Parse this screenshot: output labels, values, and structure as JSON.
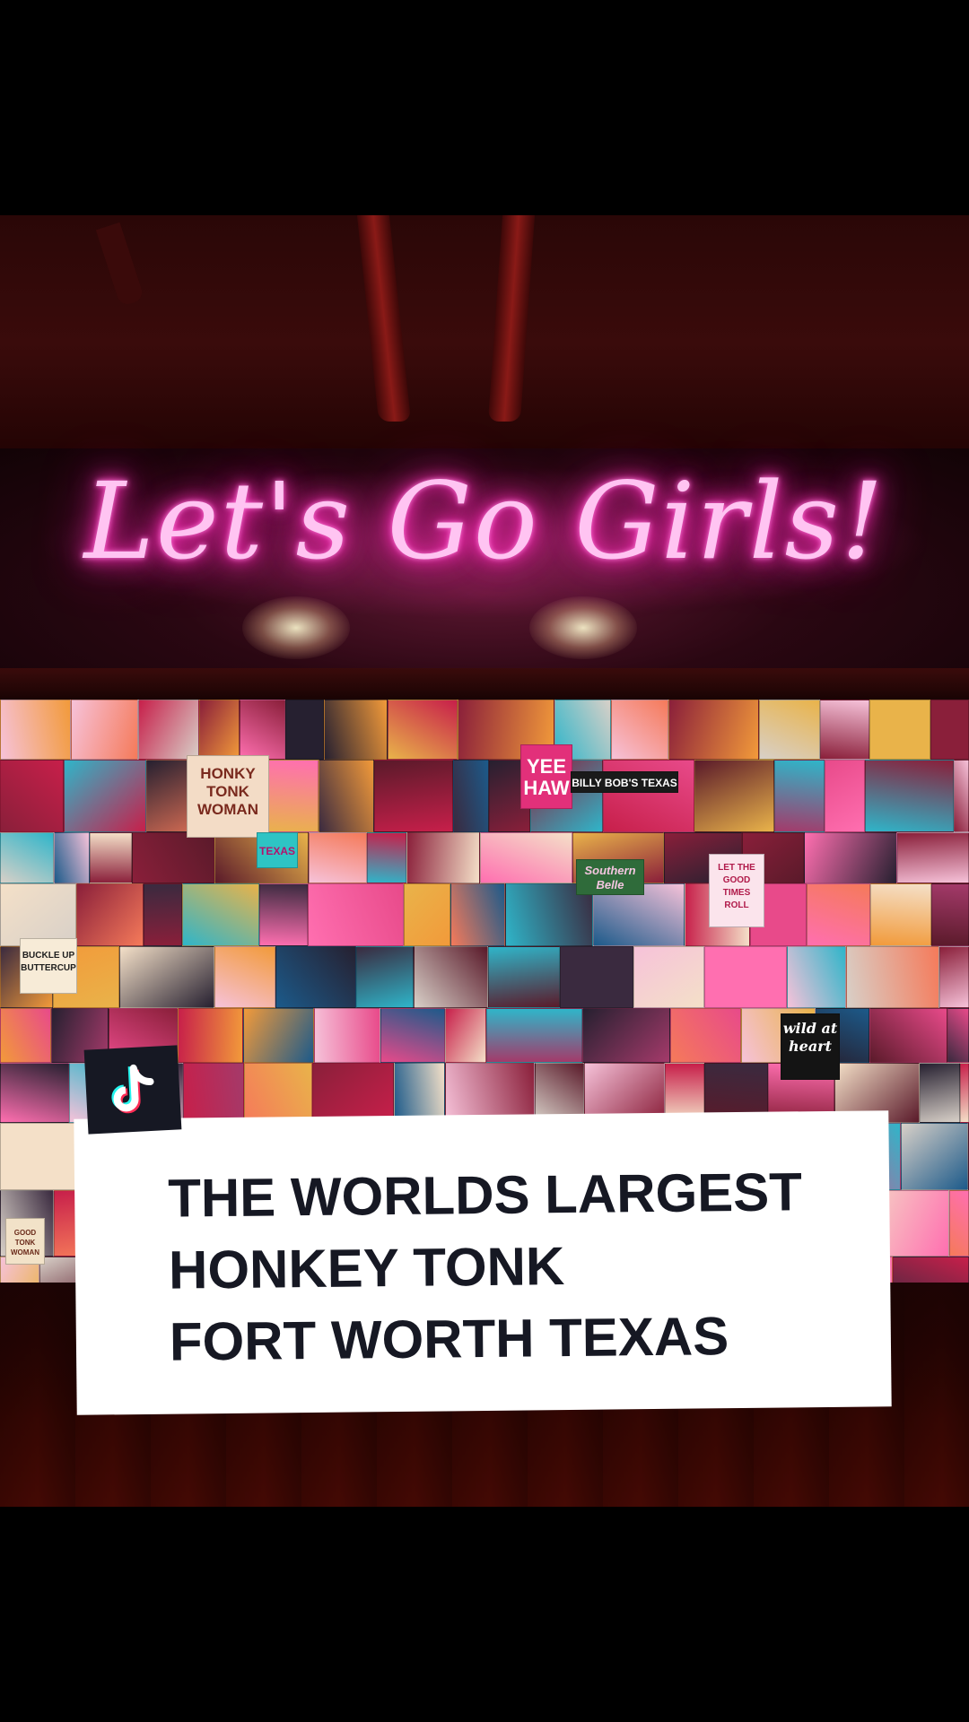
{
  "neon_sign": {
    "text": "Let's Go Girls!",
    "color": "#ff2fb8"
  },
  "collage_labels": [
    "HONKY TONK WOMAN",
    "YEE HAW",
    "BILLY BOB'S TEXAS",
    "TEXAS",
    "Southern Belle",
    "LET THE GOOD TIMES ROLL",
    "BUCKLE UP BUTTERCUP",
    "wild at heart",
    "GOOD TONK WOMAN"
  ],
  "overlay": {
    "badge_icon": "tiktok-note-icon",
    "badge_color": "#161823",
    "caption_lines": [
      "THE WORLDS LARGEST",
      "HONKEY TONK",
      "FORT WORTH TEXAS"
    ],
    "caption_color": "#161823",
    "card_color": "#ffffff"
  }
}
